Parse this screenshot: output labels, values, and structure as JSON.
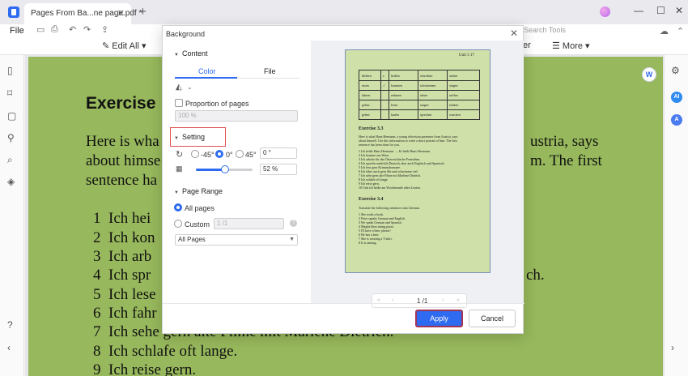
{
  "titlebar": {
    "tab_title": "Pages From Ba...ne page.pdf *",
    "tab_close": "✕",
    "add_tab": "+",
    "minimize": "—",
    "maximize": "☐",
    "close": "✕"
  },
  "menubar": {
    "file": "File",
    "search_tools": "Search Tools",
    "edit_all": "Edit All",
    "ter": "ter",
    "more": "More"
  },
  "document": {
    "heading": "Exercise",
    "paragraph": [
      "Here is wha",
      "about himse",
      "sentence ha"
    ],
    "para_right": [
      "ustria, says",
      "m. The first"
    ],
    "list": [
      {
        "num": "1",
        "text": "Ich hei"
      },
      {
        "num": "2",
        "text": "Ich kon"
      },
      {
        "num": "3",
        "text": "Ich arb"
      },
      {
        "num": "4",
        "text": "Ich spr"
      },
      {
        "num": "5",
        "text": "Ich lese"
      },
      {
        "num": "6",
        "text": "Ich fahr"
      },
      {
        "num": "7",
        "text": "Ich sehe gern alte Filme mit Marlene Dietrich."
      },
      {
        "num": "8",
        "text": "Ich schlafe oft lange."
      },
      {
        "num": "9",
        "text": "Ich reise gern."
      }
    ],
    "list_right_frag": "ch."
  },
  "dialog": {
    "title": "Background",
    "close": "✕",
    "content_section": "Content",
    "tab_color": "Color",
    "tab_file": "File",
    "proportion_label": "Proportion of pages",
    "proportion_value": "100 %",
    "setting_section": "Setting",
    "rotation_options": [
      "-45°",
      "0°",
      "45°"
    ],
    "rotation_value": "0 °",
    "opacity_value": "52 %",
    "opacity_fraction": 0.52,
    "page_range_section": "Page Range",
    "all_pages_label": "All pages",
    "custom_label": "Custom",
    "custom_placeholder": "1 /1",
    "pages_select": "All Pages",
    "pager": "1 /1",
    "apply": "Apply",
    "cancel": "Cancel"
  },
  "preview": {
    "unit": "Unit 3   17",
    "table": [
      [
        "bleiben",
        "z",
        "heißen",
        "schreiben",
        "stehen"
      ],
      [
        "essen",
        "✓",
        "kommen",
        "schwimmen",
        "singen"
      ],
      [
        "fahren",
        "",
        "nehmen",
        "sehen",
        "treffen"
      ],
      [
        "geben",
        "",
        "lesen",
        "singen",
        "trinken"
      ],
      [
        "gehen",
        "",
        "laufen",
        "sprechen",
        "waschen"
      ]
    ],
    "ex33_title": "Exercise 3.3",
    "ex33_intro": [
      "Here is what Hans Hermann, a young television presenter from Austria, says",
      "about himself. Use this information to write a short portrait of him. The first",
      "sentence has been done for you."
    ],
    "ex33_list": [
      "1  Ich heiße Hans Hermann. → Er heißt Hans Hermann.",
      "2  Ich komme aus Wien.",
      "3  Ich arbeite für das Österreichische Fernsehen.",
      "4  Ich spreche natürlich Deutsch, aber auch Englisch und Spanisch.",
      "5  Ich lese gern Kriminalromane.",
      "6  Ich fahre auch gern Ski und schwimme viel.",
      "7  Ich sehe gern alte Filme mit Marlene Dietrich.",
      "8  Ich schlafe oft lange.",
      "9  Ich reise gern.",
      "10  Und ich heiße am Wochenende allen Leuten."
    ],
    "ex34_title": "Exercise 3.4",
    "ex34_intro": "Translate the following sentences into German.",
    "ex34_list": [
      "1  She reads a book.",
      "2  Peter speaks German and English.",
      "3  We speak German and Spanish.",
      "4  Magda likes eating pizza.",
      "5  I'll have a beer, please!",
      "6  He has a beer.",
      "7  She is wearing a T-shirt.",
      "8  It is raining."
    ]
  }
}
